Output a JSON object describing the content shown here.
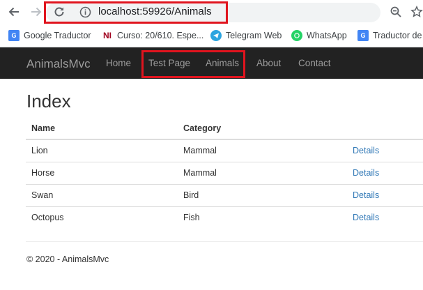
{
  "browser": {
    "url": "localhost:59926/Animals",
    "bookmarks": [
      {
        "label": "Google Traductor",
        "icon": "google-translate-icon"
      },
      {
        "label": "Curso: 20/610. Espe...",
        "icon": "ni-icon"
      },
      {
        "label": "Telegram Web",
        "icon": "telegram-icon"
      },
      {
        "label": "WhatsApp",
        "icon": "whatsapp-icon"
      },
      {
        "label": "Traductor de G",
        "icon": "google-translate-icon"
      }
    ],
    "highlight_color": "#e0141e"
  },
  "navbar": {
    "brand": "AnimalsMvc",
    "links": [
      "Home",
      "Test Page",
      "Animals",
      "About",
      "Contact"
    ],
    "background": "#222222"
  },
  "page": {
    "title": "Index",
    "table": {
      "headers": [
        "Name",
        "Category"
      ],
      "rows": [
        {
          "name": "Lion",
          "category": "Mammal",
          "action": "Details"
        },
        {
          "name": "Horse",
          "category": "Mammal",
          "action": "Details"
        },
        {
          "name": "Swan",
          "category": "Bird",
          "action": "Details"
        },
        {
          "name": "Octopus",
          "category": "Fish",
          "action": "Details"
        }
      ]
    },
    "footer": "© 2020 - AnimalsMvc"
  }
}
